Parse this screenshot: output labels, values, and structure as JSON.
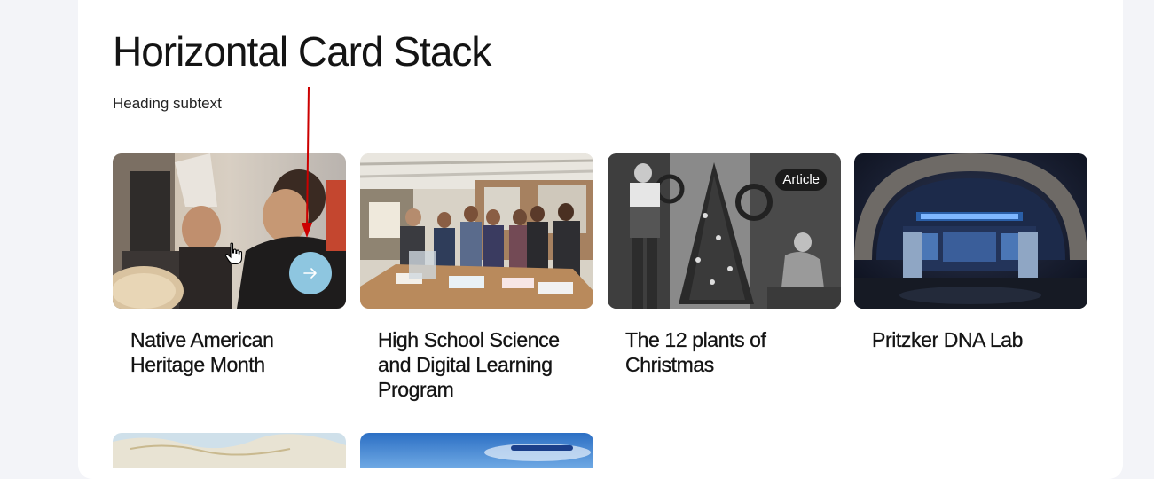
{
  "page": {
    "heading": "Horizontal Card Stack",
    "subtext": "Heading subtext"
  },
  "cards": [
    {
      "title": "Native American Heritage Month",
      "badge": "",
      "arrow_icon": "arrow-right-icon"
    },
    {
      "title": "High School Science and Digital Learning Program",
      "badge": ""
    },
    {
      "title": "The 12 plants of Christmas",
      "badge": "Article"
    },
    {
      "title": "Pritzker DNA Lab",
      "badge": ""
    }
  ],
  "colors": {
    "background": "#f3f4f8",
    "panel": "#ffffff",
    "arrow_button": "#8ec6e0",
    "annotation": "#cc0000"
  }
}
